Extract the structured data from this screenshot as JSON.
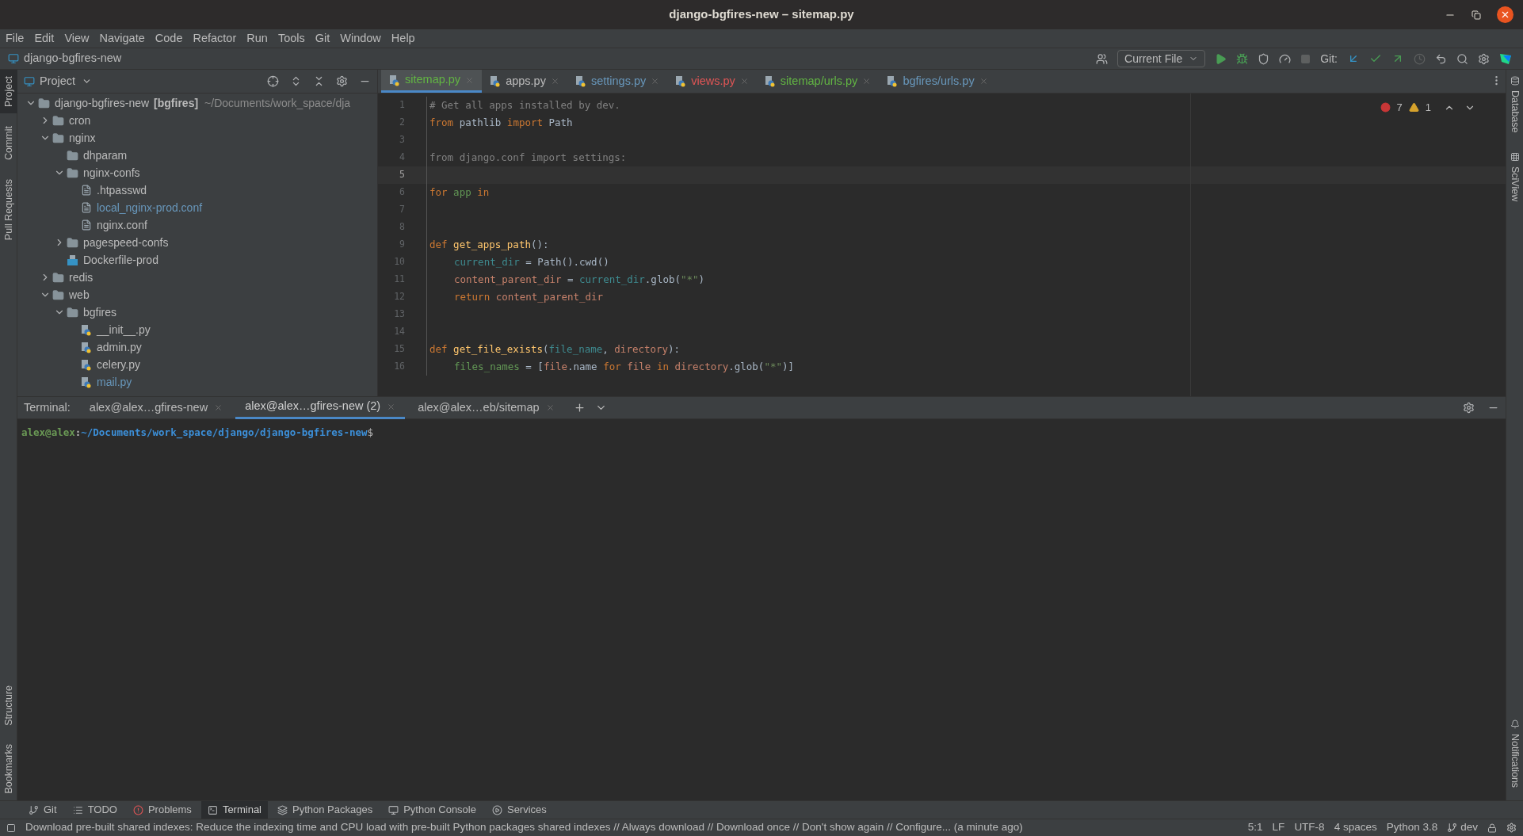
{
  "window": {
    "title": "django-bgfires-new – sitemap.py"
  },
  "menu": [
    "File",
    "Edit",
    "View",
    "Navigate",
    "Code",
    "Refactor",
    "Run",
    "Tools",
    "Git",
    "Window",
    "Help"
  ],
  "breadcrumb": "django-bgfires-new",
  "toolbar": {
    "run_config": "Current File",
    "git_label": "Git:"
  },
  "left_stripe": {
    "top": [
      {
        "label": "Project",
        "selected": true
      },
      {
        "label": "Commit",
        "selected": false
      },
      {
        "label": "Pull Requests",
        "selected": false
      }
    ],
    "bottom": [
      {
        "label": "Structure",
        "selected": false
      },
      {
        "label": "Bookmarks",
        "selected": false
      }
    ]
  },
  "right_stripe": {
    "top": [
      "Database",
      "SciView"
    ],
    "bottom": [
      "Notifications"
    ]
  },
  "project": {
    "title": "Project",
    "tree": [
      {
        "name": "django-bgfires-new",
        "module": "[bgfires]",
        "path": "~/Documents/work_space/dja",
        "kind": "folder",
        "expanded": true,
        "modified": false,
        "children": [
          {
            "name": "cron",
            "kind": "folder",
            "expanded": false,
            "modified": false
          },
          {
            "name": "nginx",
            "kind": "folder",
            "expanded": true,
            "modified": false,
            "children": [
              {
                "name": "dhparam",
                "kind": "folder",
                "modified": false
              },
              {
                "name": "nginx-confs",
                "kind": "folder",
                "expanded": true,
                "modified": false,
                "children": [
                  {
                    "name": ".htpasswd",
                    "kind": "text",
                    "modified": false
                  },
                  {
                    "name": "local_nginx-prod.conf",
                    "kind": "text",
                    "modified": true
                  },
                  {
                    "name": "nginx.conf",
                    "kind": "text",
                    "modified": false
                  }
                ]
              },
              {
                "name": "pagespeed-confs",
                "kind": "folder",
                "expanded": false,
                "modified": false
              },
              {
                "name": "Dockerfile-prod",
                "kind": "docker",
                "modified": false
              }
            ]
          },
          {
            "name": "redis",
            "kind": "folder",
            "expanded": false,
            "modified": false
          },
          {
            "name": "web",
            "kind": "folder",
            "expanded": true,
            "modified": false,
            "children": [
              {
                "name": "bgfires",
                "kind": "package",
                "expanded": true,
                "modified": false,
                "children": [
                  {
                    "name": "__init__.py",
                    "kind": "python",
                    "modified": false
                  },
                  {
                    "name": "admin.py",
                    "kind": "python",
                    "modified": false
                  },
                  {
                    "name": "celery.py",
                    "kind": "python",
                    "modified": false
                  },
                  {
                    "name": "mail.py",
                    "kind": "python",
                    "modified": true
                  }
                ]
              }
            ]
          }
        ]
      }
    ]
  },
  "editor": {
    "tabs": [
      {
        "label": "sitemap.py",
        "color": "#62b543",
        "selected": true
      },
      {
        "label": "apps.py",
        "color": "#bbbbbb",
        "selected": false
      },
      {
        "label": "settings.py",
        "color": "#6897bb",
        "selected": false
      },
      {
        "label": "views.py",
        "color": "#e05555",
        "selected": false
      },
      {
        "label": "sitemap/urls.py",
        "color": "#62b543",
        "selected": false
      },
      {
        "label": "bgfires/urls.py",
        "color": "#6897bb",
        "selected": false
      }
    ],
    "errors": "7",
    "warnings": "1",
    "lines": [
      {
        "n": "1",
        "current": false,
        "tokens": [
          {
            "t": "# Get all apps installed by dev.",
            "kind": "comment"
          }
        ]
      },
      {
        "n": "2",
        "current": false,
        "tokens": [
          {
            "t": "from ",
            "kind": "keyword"
          },
          {
            "t": "pathlib ",
            "kind": "plain"
          },
          {
            "t": "import ",
            "kind": "keyword"
          },
          {
            "t": "Path",
            "kind": "plain"
          }
        ]
      },
      {
        "n": "3",
        "current": false
      },
      {
        "n": "4",
        "current": false,
        "tokens": [
          {
            "t": "from django.conf import settings:",
            "kind": "unused"
          }
        ]
      },
      {
        "n": "5",
        "current": true
      },
      {
        "n": "6",
        "current": false,
        "tokens": [
          {
            "t": "for ",
            "kind": "keyword"
          },
          {
            "t": "app ",
            "kind": "local"
          },
          {
            "t": "in",
            "kind": "keyword"
          }
        ]
      },
      {
        "n": "7",
        "current": false
      },
      {
        "n": "8",
        "current": false
      },
      {
        "n": "9",
        "current": false,
        "tokens": [
          {
            "t": "def ",
            "kind": "keyword"
          },
          {
            "t": "get_apps_path",
            "kind": "func"
          },
          {
            "t": "():",
            "kind": "plain"
          }
        ],
        "children": [
          {
            "n": "10",
            "current": false,
            "tokens": [
              {
                "t": "current_dir",
                "kind": "param"
              },
              {
                "t": " = Path().cwd()",
                "kind": "plain"
              }
            ]
          },
          {
            "n": "11",
            "current": false,
            "tokens": [
              {
                "t": "content_parent_dir",
                "kind": "var"
              },
              {
                "t": " = ",
                "kind": "plain"
              },
              {
                "t": "current_dir",
                "kind": "param"
              },
              {
                "t": ".glob(",
                "kind": "plain"
              },
              {
                "t": "\"*\"",
                "kind": "string"
              },
              {
                "t": ")",
                "kind": "plain"
              }
            ]
          },
          {
            "n": "12",
            "current": false,
            "tokens": [
              {
                "t": "return ",
                "kind": "keyword"
              },
              {
                "t": "content_parent_dir",
                "kind": "var"
              }
            ]
          }
        ]
      },
      {
        "n": "13",
        "current": false
      },
      {
        "n": "14",
        "current": false
      },
      {
        "n": "15",
        "current": false,
        "tokens": [
          {
            "t": "def ",
            "kind": "keyword"
          },
          {
            "t": "get_file_exists",
            "kind": "func"
          },
          {
            "t": "(",
            "kind": "plain"
          },
          {
            "t": "file_name",
            "kind": "param"
          },
          {
            "t": ", ",
            "kind": "plain"
          },
          {
            "t": "directory",
            "kind": "var"
          },
          {
            "t": "):",
            "kind": "plain"
          }
        ],
        "children": [
          {
            "n": "16",
            "current": false,
            "tokens": [
              {
                "t": "files_names",
                "kind": "local"
              },
              {
                "t": " = [",
                "kind": "plain"
              },
              {
                "t": "file",
                "kind": "var"
              },
              {
                "t": ".name ",
                "kind": "plain"
              },
              {
                "t": "for ",
                "kind": "keyword"
              },
              {
                "t": "file ",
                "kind": "var"
              },
              {
                "t": "in ",
                "kind": "keyword"
              },
              {
                "t": "directory",
                "kind": "var"
              },
              {
                "t": ".glob(",
                "kind": "plain"
              },
              {
                "t": "\"*\"",
                "kind": "string"
              },
              {
                "t": ")]",
                "kind": "plain"
              }
            ]
          }
        ]
      }
    ]
  },
  "terminal": {
    "label": "Terminal:",
    "tabs": [
      {
        "label": "alex@alex…gfires-new",
        "selected": false
      },
      {
        "label": "alex@alex…gfires-new (2)",
        "selected": true
      },
      {
        "label": "alex@alex…eb/sitemap",
        "selected": false
      }
    ],
    "prompt": {
      "user": "alex@alex",
      "sep": ":",
      "path": "~/Documents/work_space/django/django-bgfires-new",
      "end": "$"
    }
  },
  "tool_tabs": [
    {
      "label": "Git",
      "kind": "git",
      "selected": false
    },
    {
      "label": "TODO",
      "kind": "todo",
      "selected": false
    },
    {
      "label": "Problems",
      "kind": "problems",
      "selected": false
    },
    {
      "label": "Terminal",
      "kind": "terminal",
      "selected": true
    },
    {
      "label": "Python Packages",
      "kind": "packages",
      "selected": false
    },
    {
      "label": "Python Console",
      "kind": "console",
      "selected": false
    },
    {
      "label": "Services",
      "kind": "services",
      "selected": false
    }
  ],
  "status_bar": {
    "message": "Download pre-built shared indexes: Reduce the indexing time and CPU load with pre-built Python packages shared indexes // Always download // Download once // Don't show again // Configure... (a minute ago)",
    "items": [
      "5:1",
      "LF",
      "UTF-8",
      "4 spaces",
      "Python 3.8"
    ],
    "branch": "dev"
  }
}
